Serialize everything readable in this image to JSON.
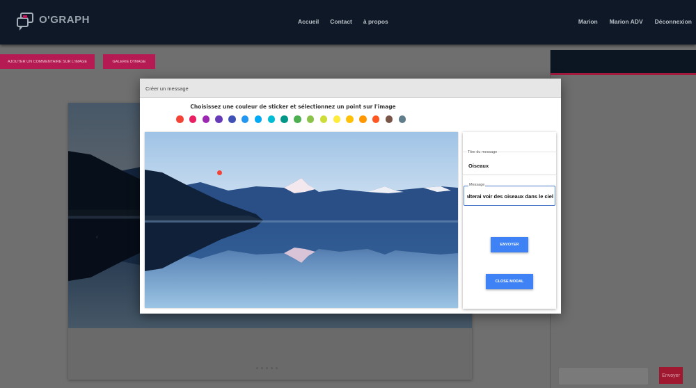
{
  "brand": {
    "name": "O'GRAPH"
  },
  "nav": {
    "left": [
      "Accueil",
      "Contact",
      "à propos"
    ],
    "right": [
      "Marion",
      "Marion ADV",
      "Déconnexion"
    ]
  },
  "page": {
    "add_comment_label": "AJOUTER UN COMMENTAIRE SUR L'IMAGE",
    "gallery_label": "GALERIE D'IMAGE",
    "prev_arrow": "‹",
    "send_label": "Envoyer"
  },
  "modal": {
    "title": "Créer un message",
    "instruction": "Choisissez une couleur de sticker et sélectionnez un point sur l'image",
    "colors": [
      "#f44336",
      "#e91e63",
      "#9c27b0",
      "#673ab7",
      "#3f51b5",
      "#2196f3",
      "#03a9f4",
      "#00bcd4",
      "#009688",
      "#4caf50",
      "#8bc34a",
      "#cddc39",
      "#ffeb3b",
      "#ffc107",
      "#ff9800",
      "#ff5722",
      "#795548",
      "#607d8b"
    ],
    "sticker_color": "#f44336",
    "form": {
      "title_label": "Titre du message",
      "title_value": "Oiseaux",
      "message_label": "Message",
      "message_value": "alterai voir des oiseaux dans le ciel",
      "send_label": "ENVOYER",
      "close_label": "CLOSE MODAL"
    }
  },
  "theme": {
    "accent": "#e91e63",
    "primary": "#3f82f5",
    "navbar": "#0e1826"
  }
}
